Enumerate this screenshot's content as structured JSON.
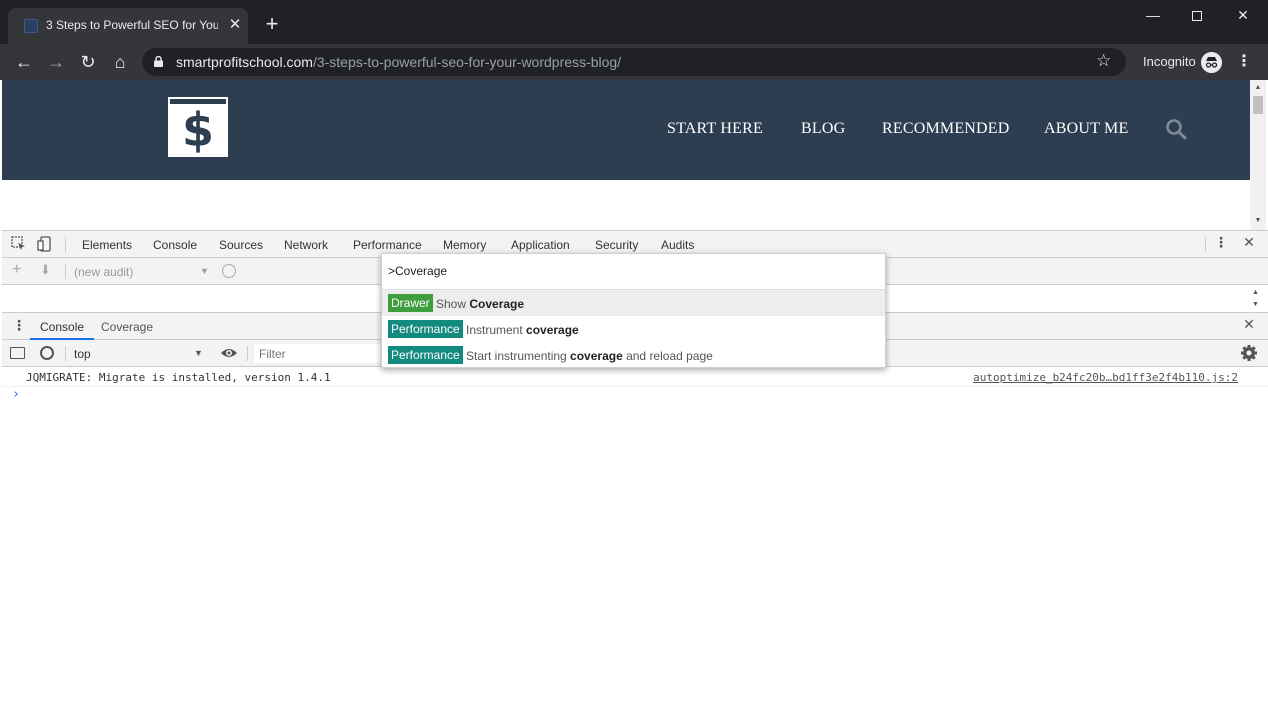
{
  "browser": {
    "tab_title": "3 Steps to Powerful SEO for Your",
    "tab_close": "✕",
    "new_tab": "+",
    "url_domain": "smartprofitschool.com",
    "url_path": "/3-steps-to-powerful-seo-for-your-wordpress-blog/",
    "incognito_label": "Incognito",
    "window_buttons": {
      "minimize": "—",
      "close": "✕"
    },
    "nav_icons": {
      "back": "←",
      "forward": "→",
      "reload": "↻",
      "home": "⌂",
      "star": "☆",
      "menu": "⋮"
    }
  },
  "site": {
    "logo_symbol": "$",
    "nav": {
      "start_here": "START HERE",
      "blog": "BLOG",
      "recommended": "RECOMMENDED",
      "about_me": "ABOUT ME"
    },
    "header_color": "#2d3e50"
  },
  "devtools": {
    "tabs": [
      "Elements",
      "Console",
      "Sources",
      "Network",
      "Performance",
      "Memory",
      "Application",
      "Security",
      "Audits"
    ],
    "audits_select": "(new audit)",
    "drawer_tabs": {
      "console": "Console",
      "coverage": "Coverage"
    },
    "context": "top",
    "filter_placeholder": "Filter",
    "log": {
      "message": "JQMIGRATE: Migrate is installed, version 1.4.1",
      "source": "autoptimize_b24fc20b…bd1ff3e2f4b110.js:2"
    },
    "prompt": "›",
    "icons": {
      "more": "⋮",
      "close": "✕",
      "add": "+",
      "download": "⬇",
      "dropdown": "▼"
    }
  },
  "command_menu": {
    "query": ">Coverage",
    "items": [
      {
        "badge": "Drawer",
        "pre": "Show ",
        "bold": "Coverage",
        "post": ""
      },
      {
        "badge": "Performance",
        "pre": "Instrument ",
        "bold": "coverage",
        "post": ""
      },
      {
        "badge": "Performance",
        "pre": "Start instrumenting ",
        "bold": "coverage",
        "post": " and reload page"
      }
    ],
    "colors": {
      "drawer": "#3e9e3e",
      "performance": "#128a7e"
    }
  }
}
